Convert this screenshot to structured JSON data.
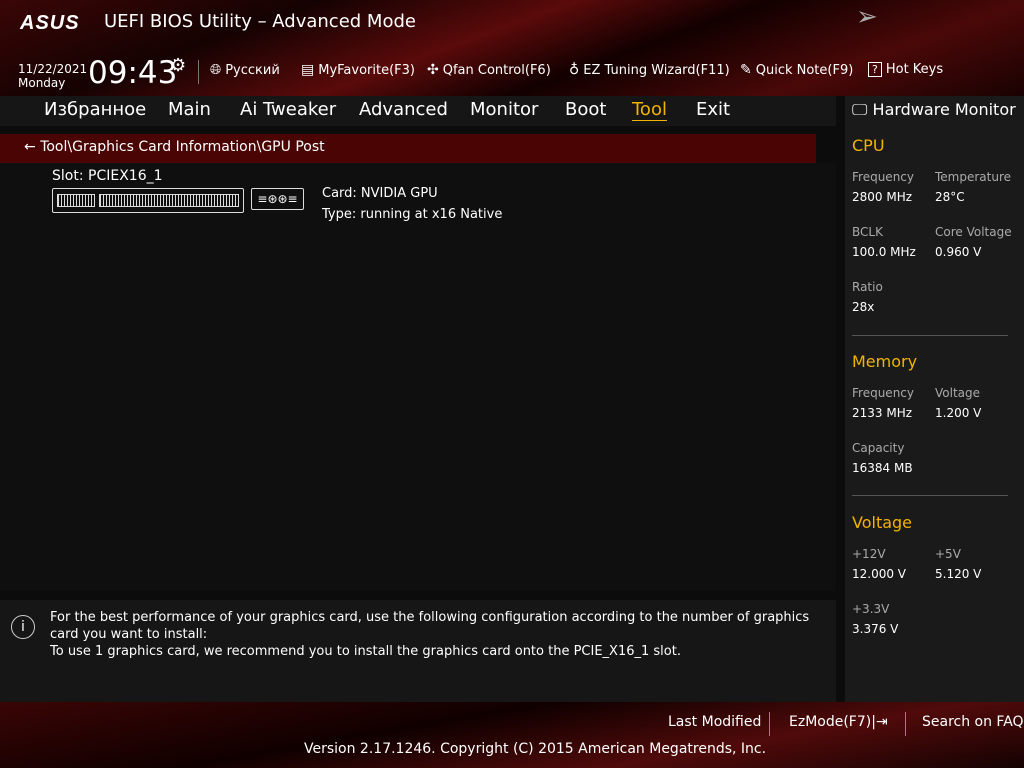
{
  "header": {
    "logo": "ASUS",
    "title": "UEFI BIOS Utility – Advanced Mode",
    "date": "11/22/2021",
    "day": "Monday",
    "time": "09:43"
  },
  "toolbar": [
    {
      "icon": "globe-icon",
      "label": "Русский"
    },
    {
      "icon": "favorite-icon",
      "label": "MyFavorite(F3)"
    },
    {
      "icon": "fan-icon",
      "label": "Qfan Control(F6)"
    },
    {
      "icon": "bulb-icon",
      "label": "EZ Tuning Wizard(F11)"
    },
    {
      "icon": "note-icon",
      "label": "Quick Note(F9)"
    },
    {
      "icon": "help-icon",
      "label": "Hot Keys"
    }
  ],
  "nav": [
    "Избранное",
    "Main",
    "Ai Tweaker",
    "Advanced",
    "Monitor",
    "Boot",
    "Tool",
    "Exit"
  ],
  "active_tab": "Tool",
  "breadcrumb": "Tool\\Graphics Card Information\\GPU Post",
  "slot": {
    "label": "Slot: PCIEX16_1",
    "card": "Card: NVIDIA GPU",
    "type": "Type: running at x16 Native"
  },
  "help": {
    "line1": "For the best performance of your graphics card, use the following configuration according to the number of graphics card you want to install:",
    "line2": "To use 1 graphics card, we recommend you to install  the graphics card onto the PCIE_X16_1 slot."
  },
  "hw": {
    "title": "Hardware Monitor",
    "cpu": {
      "title": "CPU",
      "freq_l": "Frequency",
      "freq": "2800 MHz",
      "temp_l": "Temperature",
      "temp": "28°C",
      "bclk_l": "BCLK",
      "bclk": "100.0 MHz",
      "cv_l": "Core Voltage",
      "cv": "0.960 V",
      "ratio_l": "Ratio",
      "ratio": "28x"
    },
    "mem": {
      "title": "Memory",
      "freq_l": "Frequency",
      "freq": "2133 MHz",
      "volt_l": "Voltage",
      "volt": "1.200 V",
      "cap_l": "Capacity",
      "cap": "16384 MB"
    },
    "volt": {
      "title": "Voltage",
      "v12_l": "+12V",
      "v12": "12.000 V",
      "v5_l": "+5V",
      "v5": "5.120 V",
      "v33_l": "+3.3V",
      "v33": "3.376 V"
    }
  },
  "footer": {
    "last": "Last Modified",
    "ez": "EzMode(F7)|⇥",
    "faq": "Search on FAQ",
    "version": "Version 2.17.1246. Copyright (C) 2015 American Megatrends, Inc."
  },
  "colors": {
    "accent": "#f0b400",
    "breadcrumb_bg": "#4a0404"
  }
}
